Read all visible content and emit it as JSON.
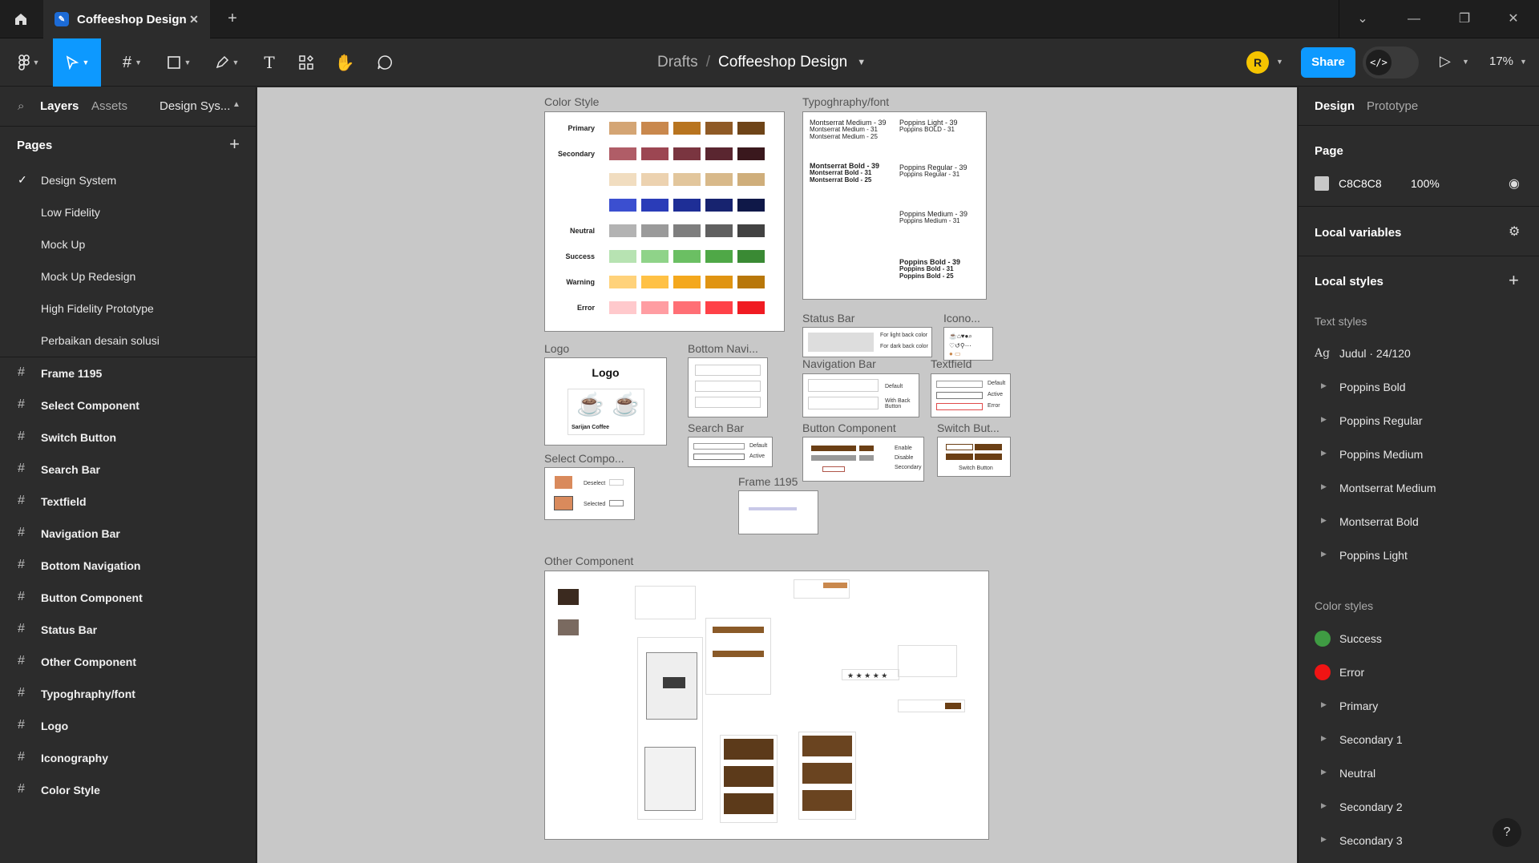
{
  "titlebar": {
    "tab_title": "Coffeeshop Design",
    "close": "✕",
    "add": "+",
    "minimize": "—",
    "restore": "❐",
    "window_close": "✕",
    "dropdown": "⌄"
  },
  "toolbar": {
    "breadcrumb_parent": "Drafts",
    "breadcrumb_sep": "/",
    "breadcrumb_file": "Coffeeshop Design",
    "avatar_initial": "R",
    "share_label": "Share",
    "dev_mode_glyph": "</>",
    "zoom": "17%",
    "accent": "#0d99ff"
  },
  "left_panel": {
    "tabs": {
      "layers": "Layers",
      "assets": "Assets",
      "page_selector": "Design Sys..."
    },
    "pages_title": "Pages",
    "pages": [
      {
        "label": "Design System",
        "active": true
      },
      {
        "label": "Low Fidelity"
      },
      {
        "label": "Mock Up"
      },
      {
        "label": "Mock Up Redesign"
      },
      {
        "label": "High Fidelity Prototype"
      },
      {
        "label": "Perbaikan desain solusi"
      }
    ],
    "frames": [
      "Frame 1195",
      "Select Component",
      "Switch Button",
      "Search Bar",
      "Textfield",
      "Navigation Bar",
      "Bottom Navigation",
      "Button Component",
      "Status Bar",
      "Other Component",
      "Typoghraphy/font",
      "Logo",
      "Iconography",
      "Color Style"
    ]
  },
  "canvas": {
    "background": "#c8c8c8",
    "frame_labels": {
      "color_style": "Color Style",
      "typography": "Typoghraphy/font",
      "logo": "Logo",
      "bottom_nav": "Bottom Navi...",
      "status_bar": "Status Bar",
      "icono": "Icono...",
      "navigation_bar": "Navigation Bar",
      "textfield": "Textfield",
      "search_bar": "Search Bar",
      "button_component": "Button Component",
      "switch_button": "Switch But...",
      "select_component": "Select Compo...",
      "frame_1195": "Frame 1195",
      "other_component": "Other Component"
    },
    "color_style": {
      "rows": [
        {
          "label": "Primary",
          "colors": [
            "#d4a574",
            "#c9884d",
            "#b8741f",
            "#8f5a26",
            "#6e4418"
          ]
        },
        {
          "label": "Secondary",
          "colors": [
            "#b05d67",
            "#9c4652",
            "#7a3540",
            "#5a2630",
            "#3a181d"
          ]
        },
        {
          "label": "",
          "colors": [
            "#f1ddc0",
            "#ecd2b0",
            "#e2c69c",
            "#d8b98a",
            "#cfae7b"
          ]
        },
        {
          "label": "",
          "colors": [
            "#3b4fd0",
            "#2a3cb8",
            "#1e2e96",
            "#17236f",
            "#0f1848"
          ]
        },
        {
          "label": "Neutral",
          "colors": [
            "#b3b3b3",
            "#9a9a9a",
            "#7e7e7e",
            "#606060",
            "#424242"
          ]
        },
        {
          "label": "Success",
          "colors": [
            "#b7e3b2",
            "#8fd389",
            "#6bbf63",
            "#4fa847",
            "#3a8a34"
          ]
        },
        {
          "label": "Warning",
          "colors": [
            "#ffd27a",
            "#ffc145",
            "#f4a81d",
            "#e09412",
            "#b8770a"
          ]
        },
        {
          "label": "Error",
          "colors": [
            "#ffc9cc",
            "#ff9da2",
            "#ff6f75",
            "#ff4148",
            "#f01b22"
          ]
        }
      ]
    },
    "typography": {
      "left": [
        "Montserrat Medium - 39",
        "Montserrat Medium - 31",
        "Montserrat Medium - 25",
        "Montserrat Bold - 39",
        "Montserrat Bold - 31",
        "Montserrat Bold - 25"
      ],
      "right": [
        "Poppins Light - 39",
        "Poppins BOLD - 31",
        "Poppins Regular - 39",
        "Poppins Regular - 31",
        "Poppins Medium - 39",
        "Poppins Medium - 31",
        "Poppins Bold - 39",
        "Poppins Bold - 31",
        "Poppins Bold - 25"
      ]
    },
    "logo": {
      "title": "Logo",
      "caption": "Sarijan Coffee"
    },
    "status_bar": {
      "light": "For light back color",
      "dark": "For dark back color"
    },
    "navigation_bar": {
      "default": "Default",
      "with_back": "With Back Button"
    },
    "textfield": {
      "default": "Default",
      "active": "Active",
      "error": "Error"
    },
    "search_bar": {
      "default": "Default",
      "active": "Active"
    },
    "button_component": {
      "enable": "Enable",
      "disable": "Disable",
      "secondary": "Secondary"
    },
    "switch_button": {
      "caption": "Switch Button"
    },
    "select_component": {
      "deselect": "Deselect",
      "selected": "Selected"
    }
  },
  "right_panel": {
    "tabs": {
      "design": "Design",
      "prototype": "Prototype"
    },
    "page_title": "Page",
    "page_color_hex": "C8C8C8",
    "page_color_opacity": "100%",
    "local_variables": "Local variables",
    "local_styles": "Local styles",
    "text_styles_title": "Text styles",
    "text_style_top": "Judul · 24/120",
    "text_styles": [
      "Poppins Bold",
      "Poppins Regular",
      "Poppins Medium",
      "Montserrat Medium",
      "Montserrat Bold",
      "Poppins Light"
    ],
    "color_styles_title": "Color styles",
    "color_styles": [
      {
        "label": "Success",
        "color": "#3f9b43"
      },
      {
        "label": "Error",
        "color": "#f01414"
      }
    ],
    "color_style_groups": [
      "Primary",
      "Secondary 1",
      "Neutral",
      "Secondary 2",
      "Secondary 3"
    ],
    "help": "?"
  }
}
